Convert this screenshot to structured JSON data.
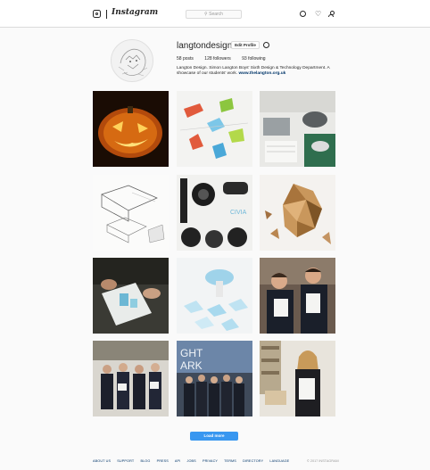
{
  "header": {
    "logo_text": "Instagram",
    "search_placeholder": "Search"
  },
  "profile": {
    "username": "langtondesign",
    "edit_label": "Edit Profile",
    "stats": {
      "posts": "58 posts",
      "followers": "128 followers",
      "following": "93 following"
    },
    "bio": "Langton Design. Simon Langton Boys' Sixth Design & Technology Department. A showcase of our students' work.",
    "bio_link": "www.thelangton.org.uk"
  },
  "posts": [
    {
      "subject": "carved pumpkin"
    },
    {
      "subject": "coloured pieces on white"
    },
    {
      "subject": "hairdryer product"
    },
    {
      "subject": "product sketches"
    },
    {
      "subject": "black product parts"
    },
    {
      "subject": "low poly lion"
    },
    {
      "subject": "hands sketching"
    },
    {
      "subject": "light blue prototypes"
    },
    {
      "subject": "two students with certificates"
    },
    {
      "subject": "group of students"
    },
    {
      "subject": "group at exhibition"
    },
    {
      "subject": "student with certificate"
    }
  ],
  "load_more_label": "Load more",
  "footer": {
    "links": [
      "ABOUT US",
      "SUPPORT",
      "BLOG",
      "PRESS",
      "API",
      "JOBS",
      "PRIVACY",
      "TERMS",
      "DIRECTORY",
      "LANGUAGE"
    ],
    "copyright": "© 2017 INSTAGRAM"
  }
}
